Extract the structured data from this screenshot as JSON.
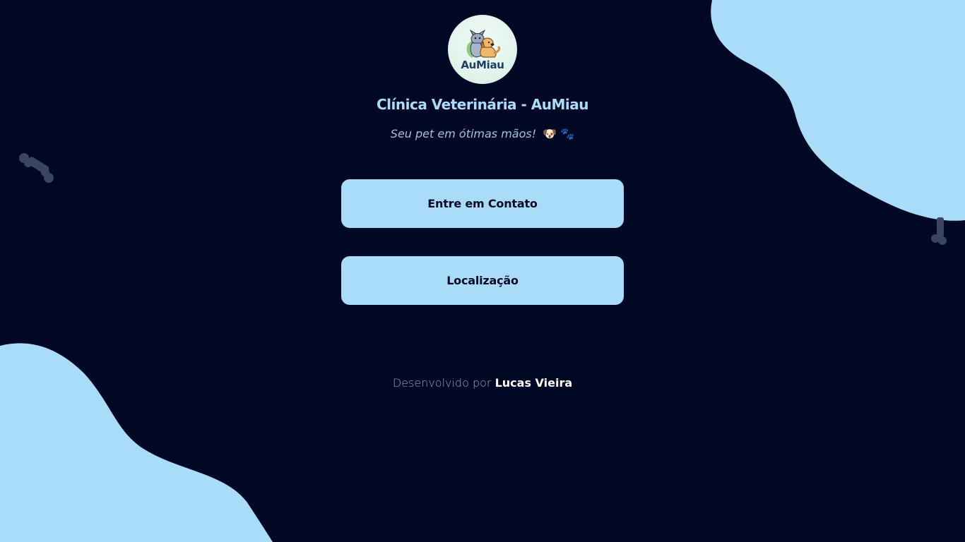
{
  "colors": {
    "background": "#000824",
    "accent": "#a9dcf8",
    "bone": "#3a4660"
  },
  "logo": {
    "text": "AuMiau",
    "icon": "cat-and-dog-logo-icon"
  },
  "header": {
    "title": "Clínica Veterinária - AuMiau",
    "subtitle": "Seu pet em ótimas mãos!",
    "subtitle_emojis": "🐶 🐾"
  },
  "buttons": {
    "contact_label": "Entre em Contato",
    "location_label": "Localização"
  },
  "footer": {
    "prefix": "Desenvolvido por",
    "author": "Lucas Vieira"
  }
}
